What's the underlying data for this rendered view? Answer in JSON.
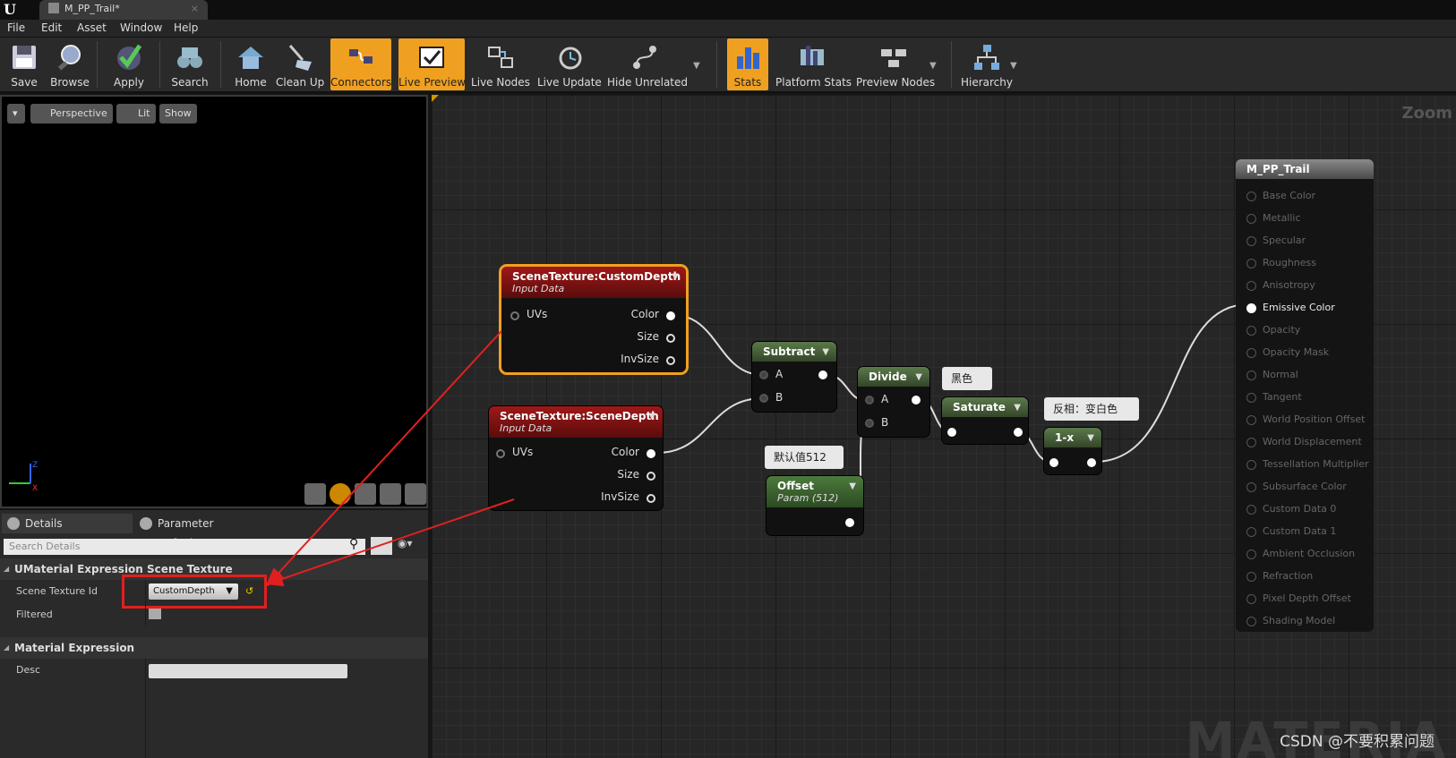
{
  "app": {
    "tab_title": "M_PP_Trail*"
  },
  "menu": [
    "File",
    "Edit",
    "Asset",
    "Window",
    "Help"
  ],
  "toolbar": {
    "buttons": [
      "Save",
      "Browse",
      "Apply",
      "Search",
      "Home",
      "Clean Up",
      "Connectors",
      "Live Preview",
      "Live Nodes",
      "Live Update",
      "Hide Unrelated",
      "Stats",
      "Platform Stats",
      "Preview Nodes",
      "Hierarchy"
    ],
    "active": [
      "Connectors",
      "Live Preview",
      "Stats"
    ],
    "active_color": "#f0a020"
  },
  "viewport": {
    "buttons": [
      "Perspective",
      "Lit",
      "Show"
    ]
  },
  "details": {
    "tabs": [
      "Details",
      "Parameter Defaults"
    ],
    "search_placeholder": "Search Details",
    "categories": [
      {
        "title": "UMaterial Expression Scene Texture",
        "props": [
          {
            "label": "Scene Texture Id",
            "value": "CustomDepth"
          },
          {
            "label": "Filtered",
            "value": ""
          }
        ]
      },
      {
        "title": "Material Expression",
        "props": [
          {
            "label": "Desc",
            "value": ""
          }
        ]
      }
    ]
  },
  "graph": {
    "zoom_label": "Zoom",
    "watermark": "MATERIA",
    "nodes": {
      "custom_depth": {
        "title": "SceneTexture:CustomDepth",
        "subtitle": "Input Data",
        "inputs": [
          "UVs"
        ],
        "outputs": [
          "Color",
          "Size",
          "InvSize"
        ]
      },
      "scene_depth": {
        "title": "SceneTexture:SceneDepth",
        "subtitle": "Input Data",
        "inputs": [
          "UVs"
        ],
        "outputs": [
          "Color",
          "Size",
          "InvSize"
        ]
      },
      "subtract": {
        "title": "Subtract",
        "inputs": [
          "A",
          "B"
        ]
      },
      "divide": {
        "title": "Divide",
        "inputs": [
          "A",
          "B"
        ]
      },
      "saturate": {
        "title": "Saturate"
      },
      "one_minus": {
        "title": "1-x"
      },
      "offset": {
        "title": "Offset",
        "subtitle": "Param (512)"
      }
    },
    "comments": [
      "黑色",
      "反相：变白色",
      "默认值512"
    ],
    "output": {
      "title": "M_PP_Trail",
      "pins": [
        "Base Color",
        "Metallic",
        "Specular",
        "Roughness",
        "Anisotropy",
        "Emissive Color",
        "Opacity",
        "Opacity Mask",
        "Normal",
        "Tangent",
        "World Position Offset",
        "World Displacement",
        "Tessellation Multiplier",
        "Subsurface Color",
        "Custom Data 0",
        "Custom Data 1",
        "Ambient Occlusion",
        "Refraction",
        "Pixel Depth Offset",
        "Shading Model"
      ],
      "active_pin": "Emissive Color"
    }
  },
  "credit": "CSDN @不要积累问题",
  "highlight_color": "#e02020"
}
